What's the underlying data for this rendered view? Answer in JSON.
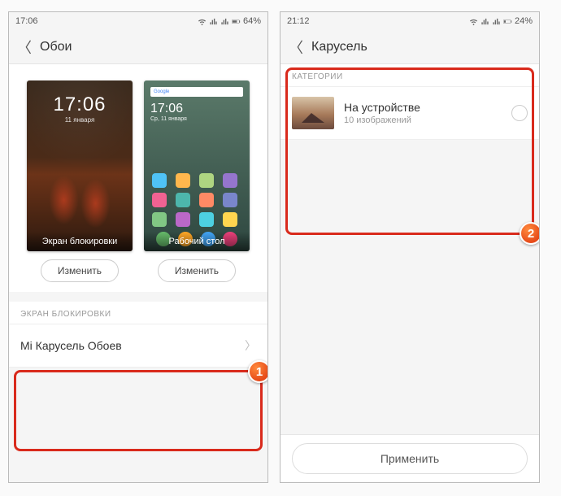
{
  "left": {
    "status": {
      "time": "17:06",
      "battery": "64%"
    },
    "header": {
      "title": "Обои"
    },
    "lock": {
      "clock": "17:06",
      "date": "11 января",
      "label": "Экран блокировки",
      "button": "Изменить"
    },
    "home": {
      "search": "Google",
      "clock": "17:06",
      "date": "Ср, 11 января",
      "label": "Рабочий стол",
      "button": "Изменить"
    },
    "section": {
      "header": "ЭКРАН БЛОКИРОВКИ",
      "row": "Mi Карусель Обоев"
    },
    "badge": "1"
  },
  "right": {
    "status": {
      "time": "21:12",
      "battery": "24%"
    },
    "header": {
      "title": "Карусель"
    },
    "section_header": "КАТЕГОРИИ",
    "category": {
      "title": "На устройстве",
      "subtitle": "10 изображений"
    },
    "apply": "Применить",
    "badge": "2"
  }
}
